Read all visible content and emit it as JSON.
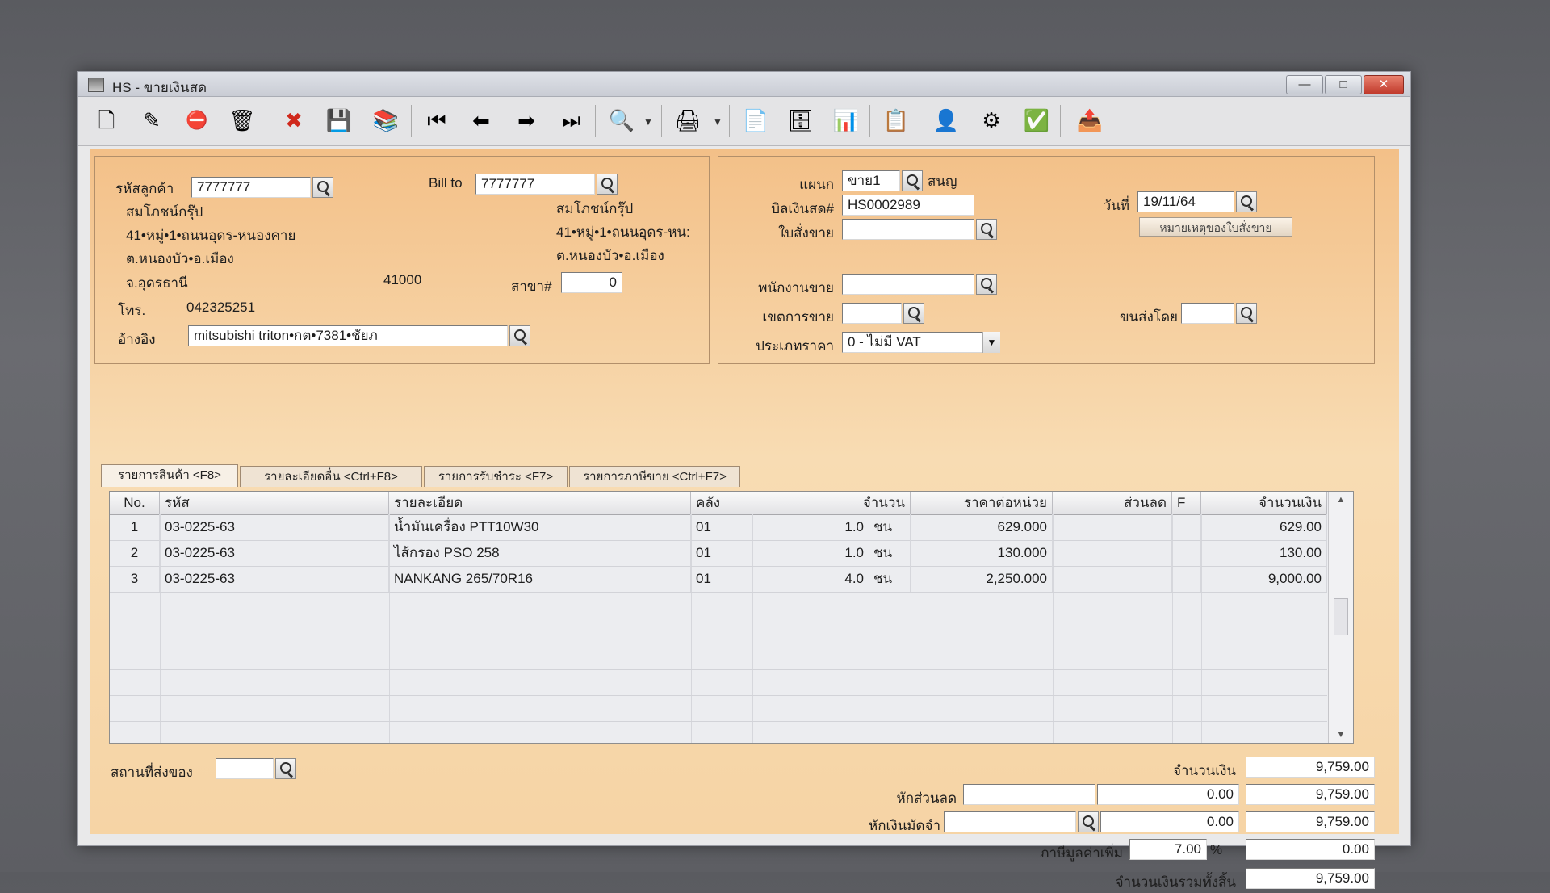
{
  "window": {
    "title": "HS - ขายเงินสด"
  },
  "customer": {
    "code_label": "รหัสลูกค้า",
    "code": "7777777",
    "name": "สมโภชน์กรุ๊ป",
    "address1": "41•หมู่•1•ถนนอุดร-หนองคาย",
    "address2": "ต.หนองบัว•อ.เมือง",
    "address3": "จ.อุดรธานี",
    "postcode": "41000",
    "phone_label": "โทร.",
    "phone": "042325251",
    "reference_label": "อ้างอิง",
    "reference": "mitsubishi triton•กต•7381•ชัยภ",
    "bill_to_label": "Bill to",
    "bill_to_code": "7777777",
    "bill_to_name": "สมโภชน์กรุ๊ป",
    "bill_to_address1": "41•หมู่•1•ถนนอุดร-หน:",
    "bill_to_address2": "ต.หนองบัว•อ.เมือง",
    "branch_label": "สาขา#",
    "branch": "0"
  },
  "document": {
    "department_label": "แผนก",
    "department": "ขาย1",
    "department_name": "สนญ",
    "bill_no_label": "บิลเงินสด#",
    "bill_no": "HS0002989",
    "order_label": "ใบสั่งขาย",
    "order": "",
    "date_label": "วันที่",
    "date": "19/11/64",
    "order_note_button": "หมายเหตุของใบสั่งขาย",
    "salesman_label": "พนักงานขาย",
    "salesman": "",
    "sales_area_label": "เขตการขาย",
    "sales_area": "",
    "ship_by_label": "ขนส่งโดย",
    "ship_by": "",
    "price_type_label": "ประเภทราคา",
    "price_type": "0 - ไม่มี VAT"
  },
  "tabs": [
    {
      "label": "รายการสินค้า <F8>"
    },
    {
      "label": "รายละเอียดอื่น <Ctrl+F8>"
    },
    {
      "label": "รายการรับชำระ <F7>"
    },
    {
      "label": "รายการภาษีขาย <Ctrl+F7>"
    }
  ],
  "grid": {
    "headers": {
      "no": "No.",
      "code": "รหัส",
      "description": "รายละเอียด",
      "warehouse": "คลัง",
      "quantity": "จำนวน",
      "unit_price": "ราคาต่อหน่วย",
      "discount": "ส่วนลด",
      "flag": "F",
      "amount": "จำนวนเงิน"
    },
    "rows": [
      {
        "no": "1",
        "code": "03-0225-63",
        "description": "น้ำมันเครื่อง PTT10W30",
        "warehouse": "01",
        "qty": "1.0",
        "unit": "ชน",
        "price": "629.000",
        "discount": "",
        "flag": "",
        "amount": "629.00"
      },
      {
        "no": "2",
        "code": "03-0225-63",
        "description": "ไส้กรอง PSO 258",
        "warehouse": "01",
        "qty": "1.0",
        "unit": "ชน",
        "price": "130.000",
        "discount": "",
        "flag": "",
        "amount": "130.00"
      },
      {
        "no": "3",
        "code": "03-0225-63",
        "description": "NANKANG 265/70R16",
        "warehouse": "01",
        "qty": "4.0",
        "unit": "ชน",
        "price": "2,250.000",
        "discount": "",
        "flag": "",
        "amount": "9,000.00"
      }
    ]
  },
  "footer": {
    "delivery_place_label": "สถานที่ส่งของ",
    "delivery_place": "",
    "amount_label": "จำนวนเงิน",
    "amount": "9,759.00",
    "discount_label": "หักส่วนลด",
    "discount_text": "",
    "discount_value": "0.00",
    "after_discount": "9,759.00",
    "deposit_label": "หักเงินมัดจำ",
    "deposit_text": "",
    "deposit_value": "0.00",
    "after_deposit": "9,759.00",
    "vat_label": "ภาษีมูลค่าเพิ่ม",
    "vat_rate": "7.00",
    "vat_percent": "%",
    "vat_amount": "0.00",
    "grand_total_label": "จำนวนเงินรวมทั้งสิ้น",
    "grand_total": "9,759.00"
  }
}
